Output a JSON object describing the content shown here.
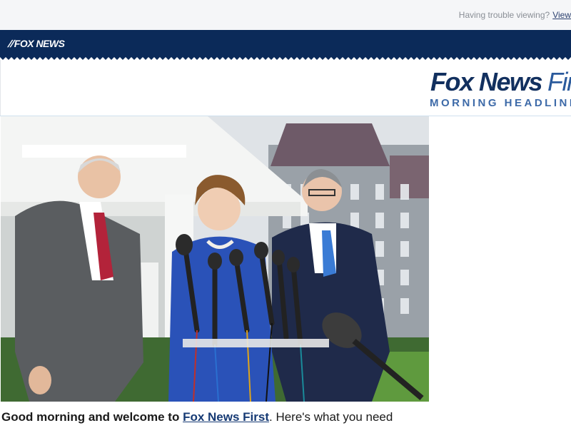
{
  "preheader": {
    "trouble_text": "Having trouble viewing?",
    "view_link": "View"
  },
  "brand": {
    "logo_text": "FOX NEWS",
    "colors": {
      "navy": "#0b2a59",
      "accent": "#3d6aa8"
    }
  },
  "masthead": {
    "title_main": "Fox News",
    "title_first": "First",
    "subtitle": "MORNING HEADLINES"
  },
  "hero": {
    "icon": "news-photo"
  },
  "intro": {
    "lead": "Good morning and welcome to",
    "link": "Fox News First",
    "rest": ". Here's what you need"
  }
}
